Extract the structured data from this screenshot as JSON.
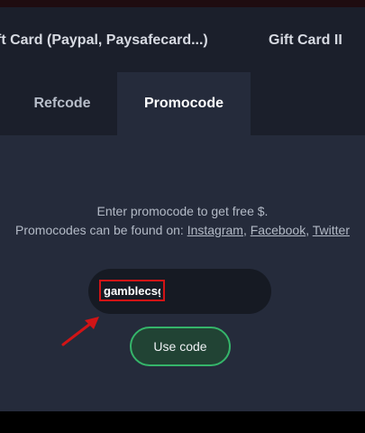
{
  "gift_nav": {
    "items": [
      "ft Card (Paypal, Paysafecard...)",
      "Gift Card II"
    ]
  },
  "tabs": [
    {
      "label": "Refcode",
      "active": false
    },
    {
      "label": "Promocode",
      "active": true
    }
  ],
  "promo": {
    "description": "Enter promocode to get free $.",
    "found_on_prefix": "Promocodes can be found on: ",
    "links": [
      "Instagram",
      "Facebook",
      "Twitter"
    ],
    "separator": ", ",
    "input_value": "gamblecsgo",
    "button_label": "Use code"
  },
  "annotation": {
    "arrow_color": "#d11416",
    "highlight_color": "#d11416"
  },
  "colors": {
    "accent_green": "#35b56a",
    "background": "#1b1f2b",
    "panel": "#252b3b"
  }
}
